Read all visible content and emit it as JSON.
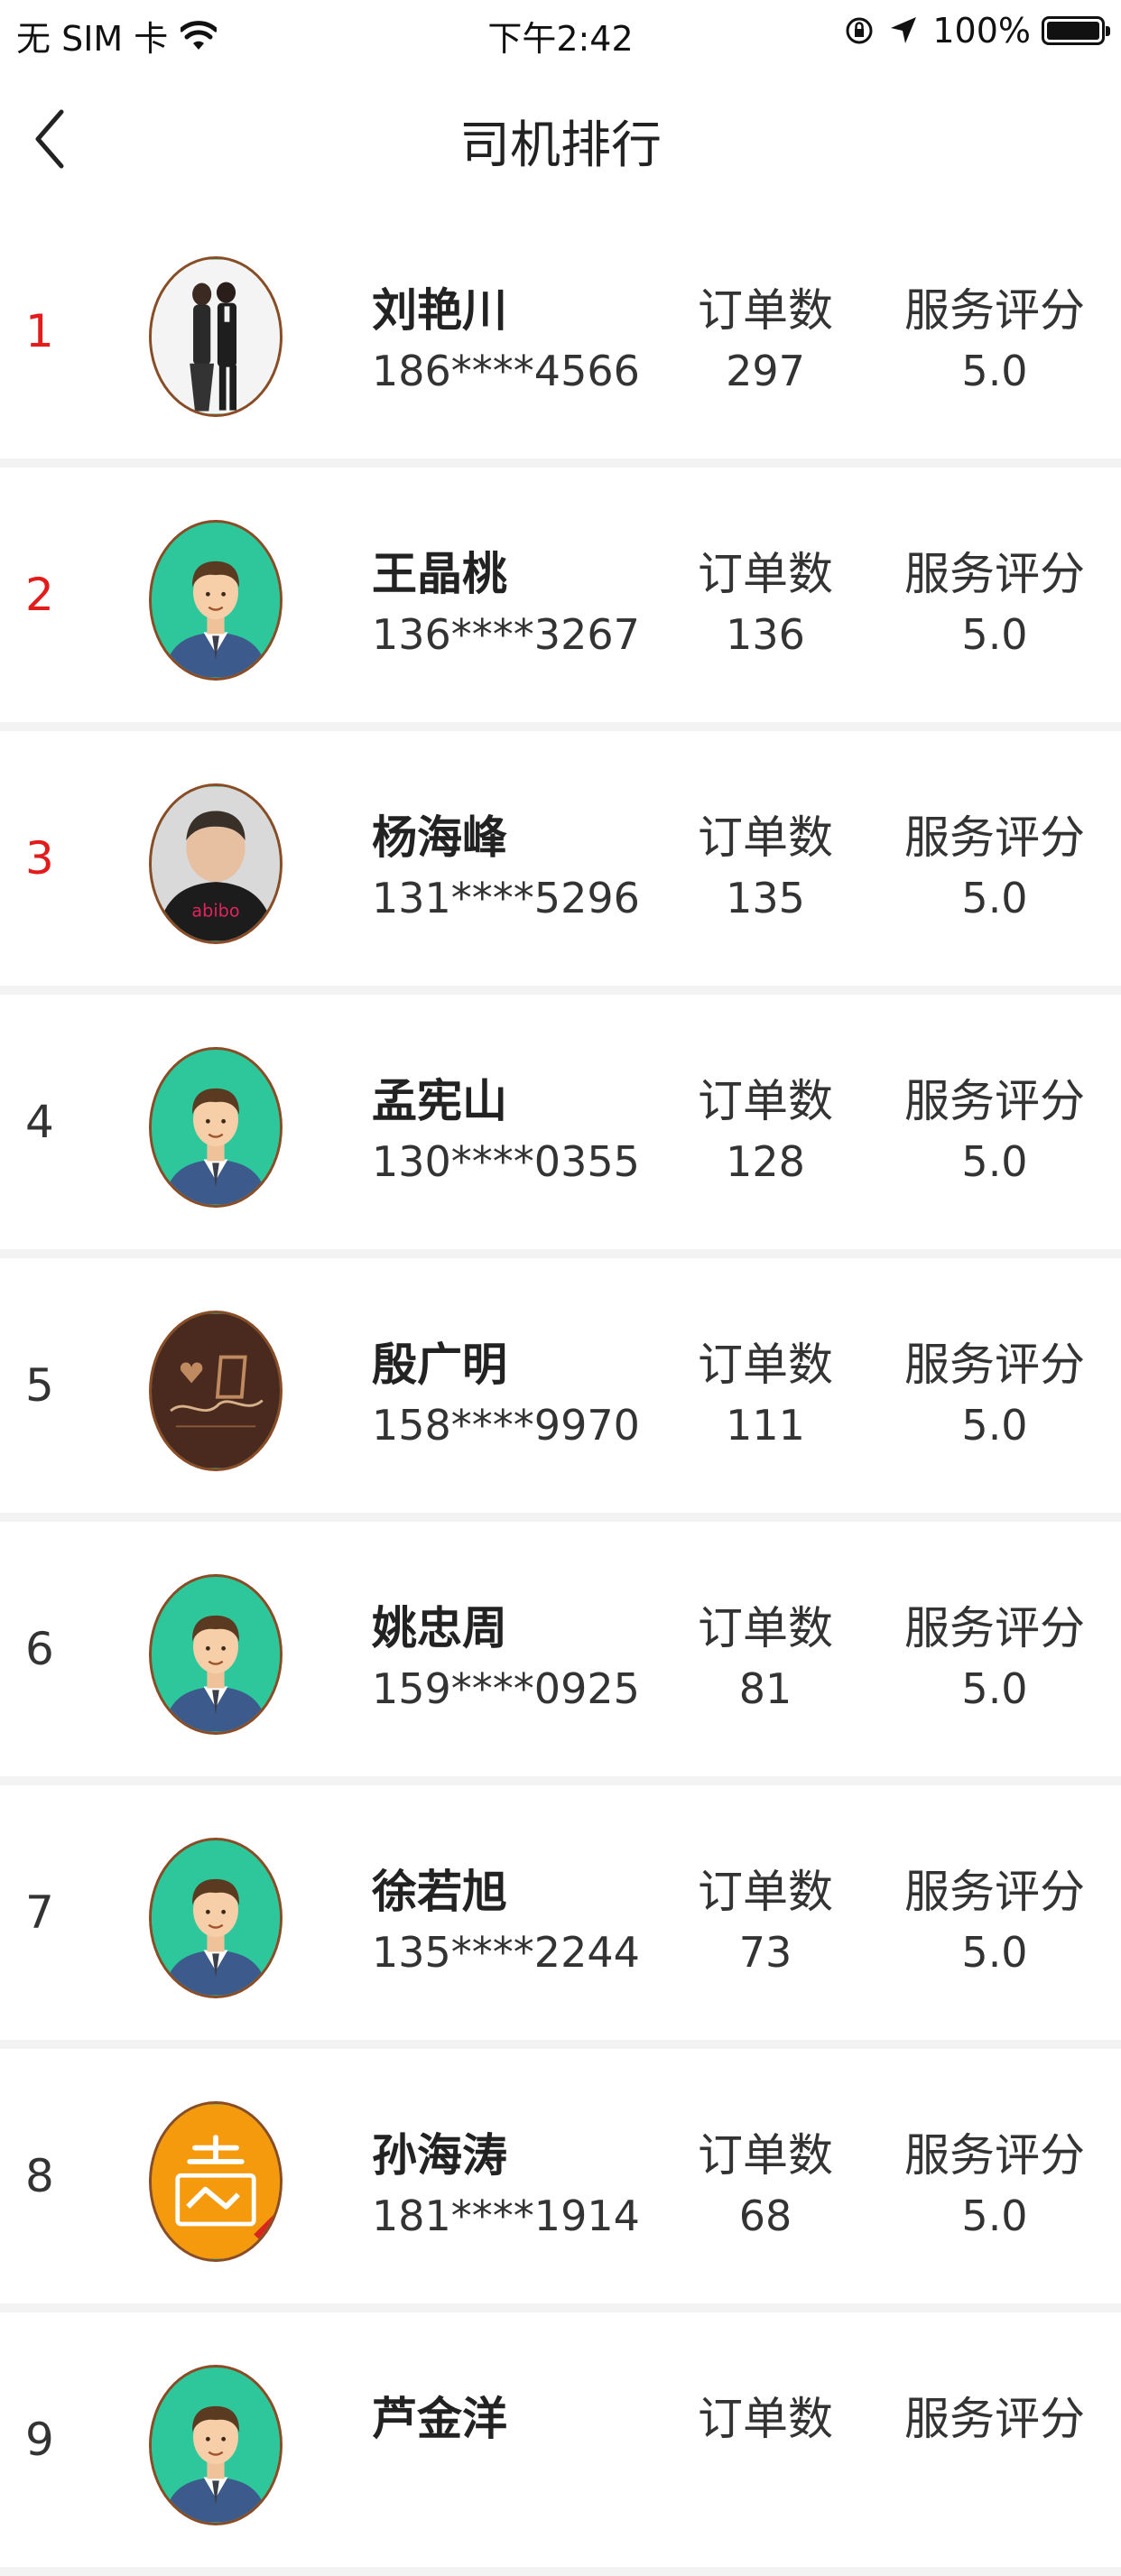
{
  "status_bar": {
    "carrier": "无 SIM 卡",
    "time": "下午2:42",
    "battery": "100%"
  },
  "nav": {
    "title": "司机排行",
    "back_icon": "chevron-left-icon"
  },
  "labels": {
    "orders": "订单数",
    "score": "服务评分"
  },
  "drivers": [
    {
      "rank": "1",
      "name": "刘艳川",
      "phone": "186****4566",
      "orders": "297",
      "score": "5.0",
      "avatar": "photo-couple"
    },
    {
      "rank": "2",
      "name": "王晶桃",
      "phone": "136****3267",
      "orders": "136",
      "score": "5.0",
      "avatar": "default-driver"
    },
    {
      "rank": "3",
      "name": "杨海峰",
      "phone": "131****5296",
      "orders": "135",
      "score": "5.0",
      "avatar": "photo-man"
    },
    {
      "rank": "4",
      "name": "孟宪山",
      "phone": "130****0355",
      "orders": "128",
      "score": "5.0",
      "avatar": "default-driver"
    },
    {
      "rank": "5",
      "name": "殷广明",
      "phone": "158****9970",
      "orders": "111",
      "score": "5.0",
      "avatar": "signature-logo"
    },
    {
      "rank": "6",
      "name": "姚忠周",
      "phone": "159****0925",
      "orders": "81",
      "score": "5.0",
      "avatar": "default-driver"
    },
    {
      "rank": "7",
      "name": "徐若旭",
      "phone": "135****2244",
      "orders": "73",
      "score": "5.0",
      "avatar": "default-driver"
    },
    {
      "rank": "8",
      "name": "孙海涛",
      "phone": "181****1914",
      "orders": "68",
      "score": "5.0",
      "avatar": "handshake-logo"
    },
    {
      "rank": "9",
      "name": "芦金洋",
      "phone": "",
      "orders": "",
      "score": "",
      "avatar": "default-driver"
    }
  ],
  "colors": {
    "top_rank": "#e21b1b",
    "avatar_green": "#2ec79b",
    "avatar_orange": "#f59a0c",
    "divider": "#f3f3f3"
  }
}
